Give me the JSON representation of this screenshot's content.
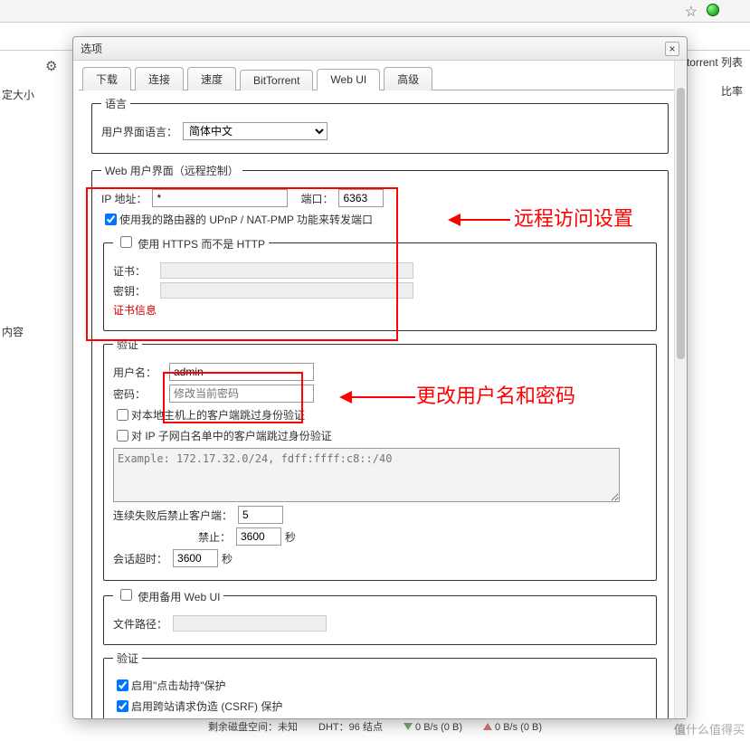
{
  "browser": {
    "star": "☆"
  },
  "bg": {
    "gear": "⚙",
    "size": "定大小",
    "torrent_list": "置 torrent 列表",
    "ratio": "比率",
    "content": "内容"
  },
  "status": {
    "disk": "剩余磁盘空间：未知",
    "dht": "DHT：96 结点",
    "dn": "0 B/s (0 B)",
    "up": "0 B/s (0 B)"
  },
  "watermark": {
    "prefix": "值",
    "text": "什么值得买"
  },
  "dialog_title": "选项",
  "tabs": {
    "download": "下载",
    "connection": "连接",
    "speed": "速度",
    "bittorrent": "BitTorrent",
    "webui": "Web UI",
    "advanced": "高级"
  },
  "lang": {
    "legend": "语言",
    "label": "用户界面语言：",
    "value": "简体中文"
  },
  "webui": {
    "legend": "Web 用户界面（远程控制）",
    "ip_label": "IP 地址：",
    "ip_value": "*",
    "port_label": "端口：",
    "port_value": "6363",
    "upnp": "使用我的路由器的 UPnP / NAT-PMP 功能来转发端口",
    "https_legend": "使用 HTTPS 而不是 HTTP",
    "cert_label": "证书：",
    "key_label": "密钥：",
    "cert_info": "证书信息"
  },
  "auth": {
    "legend": "验证",
    "user_label": "用户名：",
    "user_value": "admin",
    "pass_label": "密码：",
    "pass_placeholder": "修改当前密码",
    "bypass_local": "对本地主机上的客户端跳过身份验证",
    "bypass_subnet": "对 IP 子网白名单中的客户端跳过身份验证",
    "example": "Example: 172.17.32.0/24, fdff:ffff:c8::/40",
    "ban_label": "连续失败后禁止客户端：",
    "ban_value": "5",
    "ban_for_label": "禁止：",
    "ban_for_value": "3600",
    "seconds": "秒",
    "session_label": "会话超时：",
    "session_value": "3600"
  },
  "altui": {
    "legend": "使用备用 Web UI",
    "path_label": "文件路径："
  },
  "sec": {
    "legend": "验证",
    "clickjack": "启用\"点击劫持\"保护",
    "csrf": "启用跨站请求伪造 (CSRF) 保护"
  },
  "annot": {
    "remote": "远程访问设置",
    "userpass": "更改用户名和密码"
  }
}
